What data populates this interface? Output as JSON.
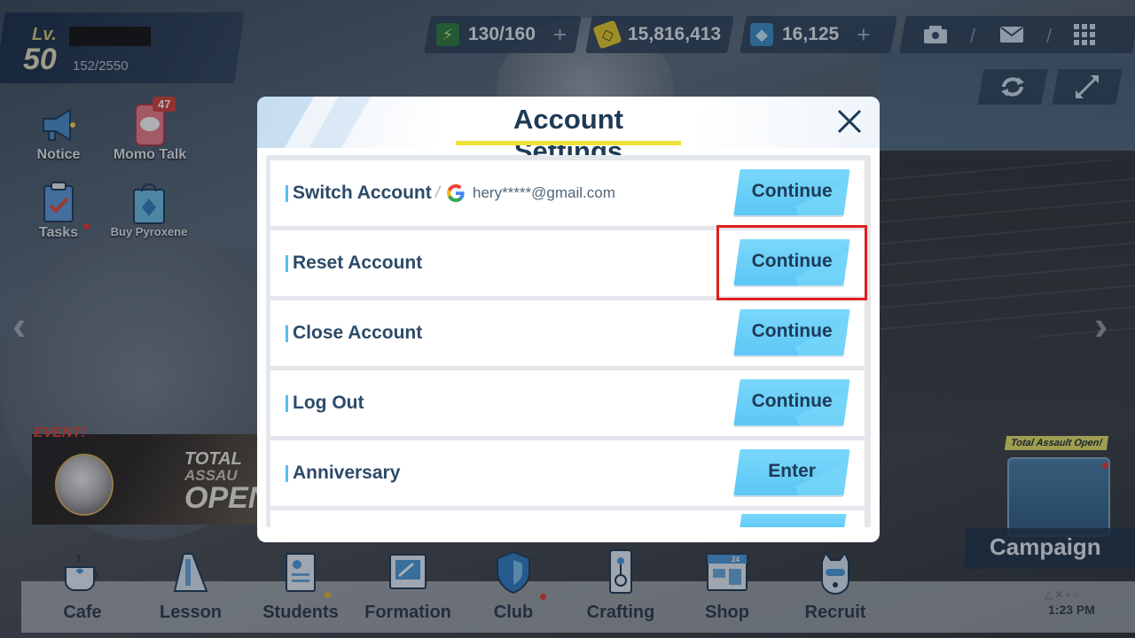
{
  "hud": {
    "level_label": "Lv.",
    "level": "50",
    "exp": "152/2550",
    "ap": "130/160",
    "credits": "15,816,413",
    "pyroxene": "16,125"
  },
  "shortcuts": {
    "notice": "Notice",
    "momotalk": "Momo Talk",
    "momotalk_badge": "47",
    "tasks": "Tasks",
    "buy_pyroxene": "Buy Pyroxene"
  },
  "event": {
    "tag": "EVENT!",
    "line1": "TOTAL",
    "line2": "ASSAU",
    "line3": "OPEN"
  },
  "campaign": {
    "tag": "Total Assault Open!",
    "label": "Campaign"
  },
  "bottom_nav": [
    {
      "label": "Cafe"
    },
    {
      "label": "Lesson"
    },
    {
      "label": "Students"
    },
    {
      "label": "Formation"
    },
    {
      "label": "Club"
    },
    {
      "label": "Crafting"
    },
    {
      "label": "Shop"
    },
    {
      "label": "Recruit"
    }
  ],
  "clock": "1:23 PM",
  "dialog": {
    "title": "Account Settings",
    "rows": [
      {
        "label": "Switch Account",
        "email": "hery*****@gmail.com",
        "button": "Continue"
      },
      {
        "label": "Reset Account",
        "button": "Continue"
      },
      {
        "label": "Close Account",
        "button": "Continue"
      },
      {
        "label": "Log Out",
        "button": "Continue"
      },
      {
        "label": "Anniversary",
        "button": "Enter"
      }
    ]
  },
  "colors": {
    "accent_button": "#5cc6f5",
    "title_underline": "#f0e23a",
    "highlight_box": "#e01e1e"
  }
}
